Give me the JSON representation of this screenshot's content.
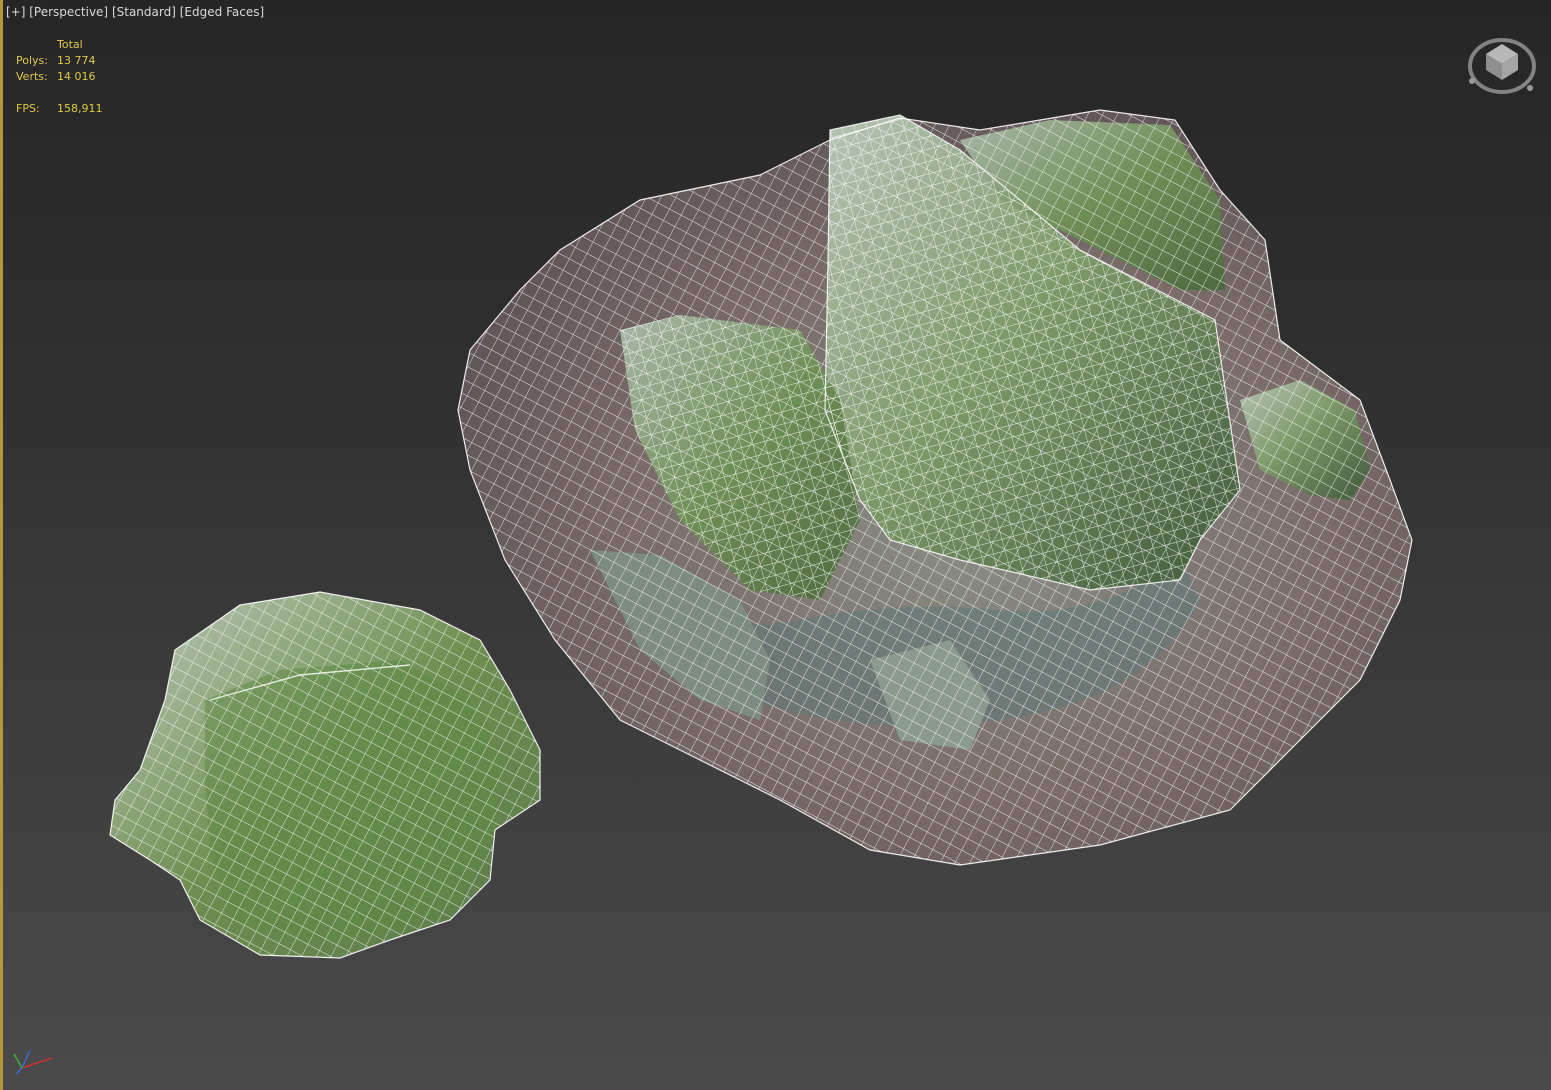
{
  "viewport": {
    "label_plus": "[+]",
    "label_view": "[Perspective]",
    "label_shading": "[Standard]",
    "label_display": "[Edged Faces]"
  },
  "stats": {
    "header": "Total",
    "polys_label": "Polys:",
    "polys_value": "13 774",
    "verts_label": "Verts:",
    "verts_value": "14 016",
    "fps_label": "FPS:",
    "fps_value": "158,911"
  },
  "viewcube": {
    "icon": "viewcube-icon"
  },
  "axis": {
    "icon": "axis-tripod-icon"
  },
  "colors": {
    "stats_text": "#e2c84a",
    "active_border": "#b5973a",
    "wire": "#ffffff",
    "moss": "#6f8f4e",
    "rock": "#8f9e92",
    "ground": "#7a6b66"
  }
}
